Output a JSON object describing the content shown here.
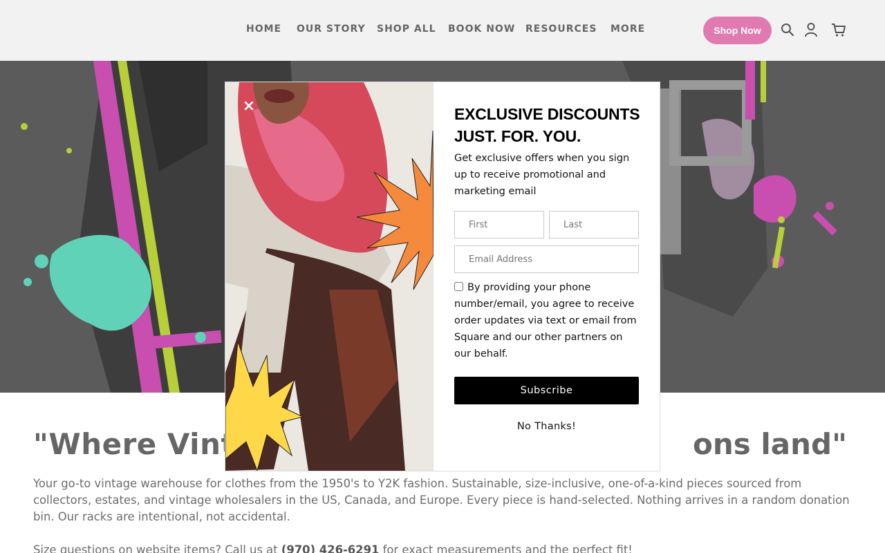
{
  "header": {
    "nav": [
      "HOME",
      "OUR STORY",
      "SHOP ALL",
      "BOOK NOW",
      "RESOURCES",
      "MORE"
    ],
    "shop_now": "Shop Now",
    "icons": [
      "search-icon",
      "account-icon",
      "cart-icon"
    ]
  },
  "hero": {
    "overlay_color": "#5a5a5a"
  },
  "content": {
    "tagline_left": "\"Where Vinta",
    "tagline_right": "ons land\"",
    "description": "Your go-to vintage warehouse for clothes from the 1950's to Y2K fashion. Sustainable, size-inclusive, one-of-a-kind pieces sourced from collectors, estates, and vintage wholesalers in the US, Canada, and Europe. Every piece is hand-selected. Nothing arrives in a random donation bin. Our racks are intentional, not accidental.",
    "size_prefix": "Size questions on website items? Call us at ",
    "phone": "(970) 426-6291",
    "size_suffix": " for exact measurements and the perfect fit!"
  },
  "modal": {
    "close": "×",
    "title": "EXCLUSIVE DISCOUNTS JUST. FOR. YOU.",
    "subtitle": "Get exclusive offers when you sign up to receive promotional and marketing email",
    "first_placeholder": "First",
    "last_placeholder": "Last",
    "email_placeholder": "Email Address",
    "consent": "By providing your phone number/email, you agree to receive order updates via text or email from Square and our other partners on our behalf.",
    "subscribe": "Subscribe",
    "no_thanks": "No Thanks!"
  },
  "colors": {
    "accent_pink": "#e07ab0",
    "header_bg": "#f2f2f2",
    "starburst_orange": "#f58a3c",
    "starburst_yellow": "#ffd84a"
  }
}
